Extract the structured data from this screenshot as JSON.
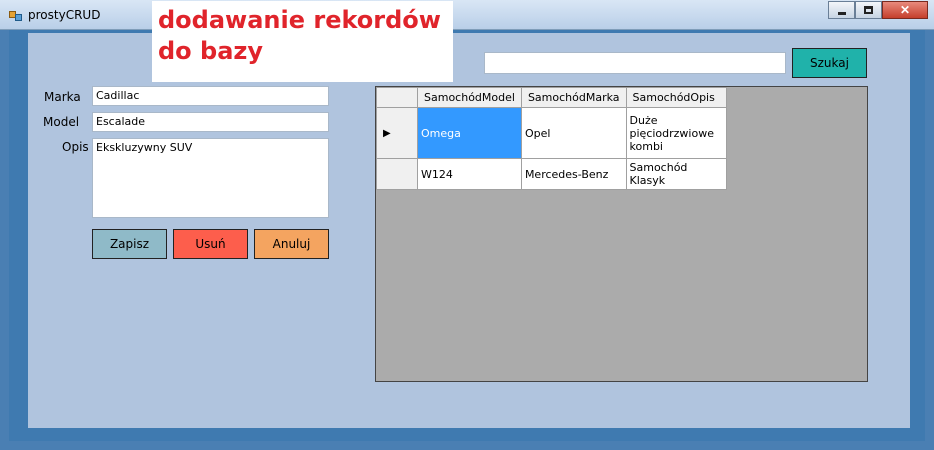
{
  "window": {
    "title": "prostyCRUD",
    "close_glyph": "✕"
  },
  "overlay": {
    "line1": "dodawanie rekordów",
    "line2": "do bazy"
  },
  "search": {
    "value": "",
    "button_label": "Szukaj"
  },
  "form": {
    "marka_label": "Marka",
    "marka_value": "Cadillac",
    "model_label": "Model",
    "model_value": "Escalade",
    "opis_label": "Opis",
    "opis_value": "Ekskluzywny SUV"
  },
  "buttons": {
    "save": "Zapisz",
    "delete": "Usuń",
    "cancel": "Anuluj"
  },
  "grid": {
    "columns": [
      "SamochódModel",
      "SamochódMarka",
      "SamochódOpis"
    ],
    "rows": [
      {
        "model": "Omega",
        "marka": "Opel",
        "opis": "Duże pięciodrzwiowe kombi"
      },
      {
        "model": "W124",
        "marka": "Mercedes-Benz",
        "opis": "Samochód Klasyk"
      }
    ],
    "current_row_glyph": "▶"
  },
  "colors": {
    "search_button": "#20b2aa",
    "save_button": "#8fbac8",
    "delete_button": "#fd5e4c",
    "cancel_button": "#f4a460",
    "selection": "#3399ff"
  }
}
